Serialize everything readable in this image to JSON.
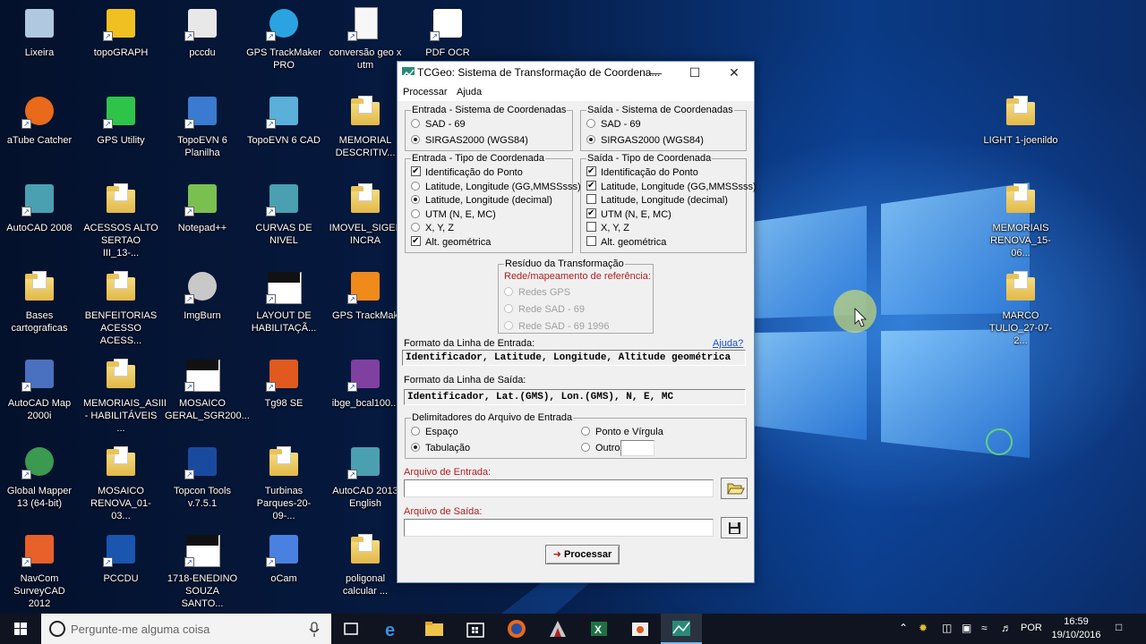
{
  "desktop_icons": [
    {
      "label": "Lixeira",
      "icon": "recycle-bin-icon"
    },
    {
      "label": "topoGRAPH",
      "icon": "topograph-icon"
    },
    {
      "label": "pccdu",
      "icon": "settings-file-icon"
    },
    {
      "label": "GPS TrackMaker PRO",
      "icon": "globe-icon"
    },
    {
      "label": "conversão geo x utm",
      "icon": "document-icon"
    },
    {
      "label": "PDF OCR",
      "icon": "pdf-icon"
    },
    {
      "label": "aTube Catcher",
      "icon": "atube-icon"
    },
    {
      "label": "GPS Utility",
      "icon": "gps-utility-icon"
    },
    {
      "label": "TopoEVN 6 Planilha",
      "icon": "spreadsheet-icon"
    },
    {
      "label": "TopoEVN 6 CAD",
      "icon": "cad-icon"
    },
    {
      "label": "MEMORIAL DESCRITIV...",
      "icon": "folder-icon"
    },
    {
      "label": "AutoCAD 2008",
      "icon": "autocad-icon"
    },
    {
      "label": "ACESSOS ALTO SERTAO III_13-...",
      "icon": "folder-icon"
    },
    {
      "label": "Notepad++",
      "icon": "notepad-icon"
    },
    {
      "label": "CURVAS DE NIVEL",
      "icon": "autocad-icon"
    },
    {
      "label": "IMOVEL_SIGEF INCRA",
      "icon": "folder-icon"
    },
    {
      "label": "Bases cartograficas",
      "icon": "folder-icon"
    },
    {
      "label": "BENFEITORIAS ACESSO ACESS...",
      "icon": "folder-icon"
    },
    {
      "label": "ImgBurn",
      "icon": "disc-icon"
    },
    {
      "label": "LAYOUT DE HABILITAÇÃ...",
      "icon": "drawing-icon"
    },
    {
      "label": "GPS TrackMak",
      "icon": "gps-trackmaker-icon"
    },
    {
      "label": "AutoCAD Map 2000i",
      "icon": "map-icon"
    },
    {
      "label": "MEMORIAIS_ASIII - HABILITÁVEIS ...",
      "icon": "folder-icon"
    },
    {
      "label": "MOSAICO GERAL_SGR200...",
      "icon": "drawing-icon"
    },
    {
      "label": "Tg98 SE",
      "icon": "tg98-icon"
    },
    {
      "label": "ibge_bcal100...",
      "icon": "archive-icon"
    },
    {
      "label": "Global Mapper 13 (64-bit)",
      "icon": "global-mapper-icon"
    },
    {
      "label": "MOSAICO RENOVA_01-03...",
      "icon": "folder-icon"
    },
    {
      "label": "Topcon Tools v.7.5.1",
      "icon": "topcon-icon"
    },
    {
      "label": "Turbinas Parques-20-09-...",
      "icon": "folder-icon"
    },
    {
      "label": "AutoCAD 2013 English",
      "icon": "autocad-icon"
    },
    {
      "label": "NavCom SurveyCAD 2012",
      "icon": "navcom-icon"
    },
    {
      "label": "PCCDU",
      "icon": "fc-cdu-icon"
    },
    {
      "label": "1718-ENEDINO SOUZA SANTO...",
      "icon": "drawing-icon"
    },
    {
      "label": "oCam",
      "icon": "ocam-icon"
    },
    {
      "label": "poligonal calcular ...",
      "icon": "folder-icon"
    },
    {
      "label": "LIGHT 1-joenildo",
      "icon": "folder-icon"
    },
    {
      "label": "MEMORIAIS RENOVA_15-06...",
      "icon": "folder-icon"
    },
    {
      "label": "MARCO TULIO_27-07-2...",
      "icon": "folder-icon"
    }
  ],
  "dialog": {
    "title": "TCGeo: Sistema de Transformação de Coordena...",
    "menu": [
      "Processar",
      "Ajuda"
    ],
    "entrada_sistema": {
      "label": "Entrada - Sistema de Coordenadas",
      "options": [
        "SAD - 69",
        "SIRGAS2000 (WGS84)"
      ],
      "selected": 1
    },
    "saida_sistema": {
      "label": "Saída - Sistema de Coordenadas",
      "options": [
        "SAD - 69",
        "SIRGAS2000 (WGS84)"
      ],
      "selected": 1
    },
    "entrada_tipo": {
      "label": "Entrada - Tipo de Coordenada",
      "items": [
        {
          "kind": "check",
          "label": "Identificação do Ponto",
          "checked": true
        },
        {
          "kind": "radio",
          "label": "Latitude, Longitude (GG,MMSSsss)",
          "checked": false
        },
        {
          "kind": "radio",
          "label": "Latitude, Longitude (decimal)",
          "checked": true
        },
        {
          "kind": "radio",
          "label": "UTM (N, E, MC)",
          "checked": false
        },
        {
          "kind": "radio",
          "label": "X, Y, Z",
          "checked": false
        },
        {
          "kind": "check",
          "label": "Alt. geométrica",
          "checked": true
        }
      ]
    },
    "saida_tipo": {
      "label": "Saída - Tipo de Coordenada",
      "items": [
        {
          "kind": "check",
          "label": "Identificação do Ponto",
          "checked": true
        },
        {
          "kind": "check",
          "label": "Latitude, Longitude (GG,MMSSsss)",
          "checked": true
        },
        {
          "kind": "check",
          "label": "Latitude, Longitude (decimal)",
          "checked": false
        },
        {
          "kind": "check",
          "label": "UTM (N, E, MC)",
          "checked": true
        },
        {
          "kind": "check",
          "label": "X, Y, Z",
          "checked": false
        },
        {
          "kind": "check",
          "label": "Alt. geométrica",
          "checked": false
        }
      ]
    },
    "residuo": {
      "label": "Resíduo da Transformação",
      "sublabel": "Rede/mapeamento de referência:",
      "options": [
        "Redes GPS",
        "Rede SAD - 69",
        "Rede SAD - 69 1996"
      ]
    },
    "formato_entrada": {
      "label": "Formato da Linha de Entrada:",
      "help": "Ajuda?",
      "value": "Identificador, Latitude, Longitude, Altitude geométrica"
    },
    "formato_saida": {
      "label": "Formato da Linha de Saída:",
      "value": "Identificador, Lat.(GMS), Lon.(GMS), N, E, MC"
    },
    "delimitadores": {
      "label": "Delimitadores do Arquivo de Entrada",
      "espaco": "Espaço",
      "tabulacao": "Tabulação",
      "ponto_virgula": "Ponto e Vírgula",
      "outro": "Outro:",
      "selected": "tabulacao"
    },
    "arquivo_entrada": {
      "label": "Arquivo de Entrada:",
      "value": ""
    },
    "arquivo_saida": {
      "label": "Arquivo de Saída:",
      "value": ""
    },
    "processar_button": "Processar"
  },
  "taskbar": {
    "search_placeholder": "Pergunte-me alguma coisa",
    "language": "POR",
    "time": "16:59",
    "date": "19/10/2016"
  },
  "colors": {
    "accent": "#76b9ed",
    "warning_text": "#b02020",
    "disabled_text": "#a0a0a0"
  }
}
